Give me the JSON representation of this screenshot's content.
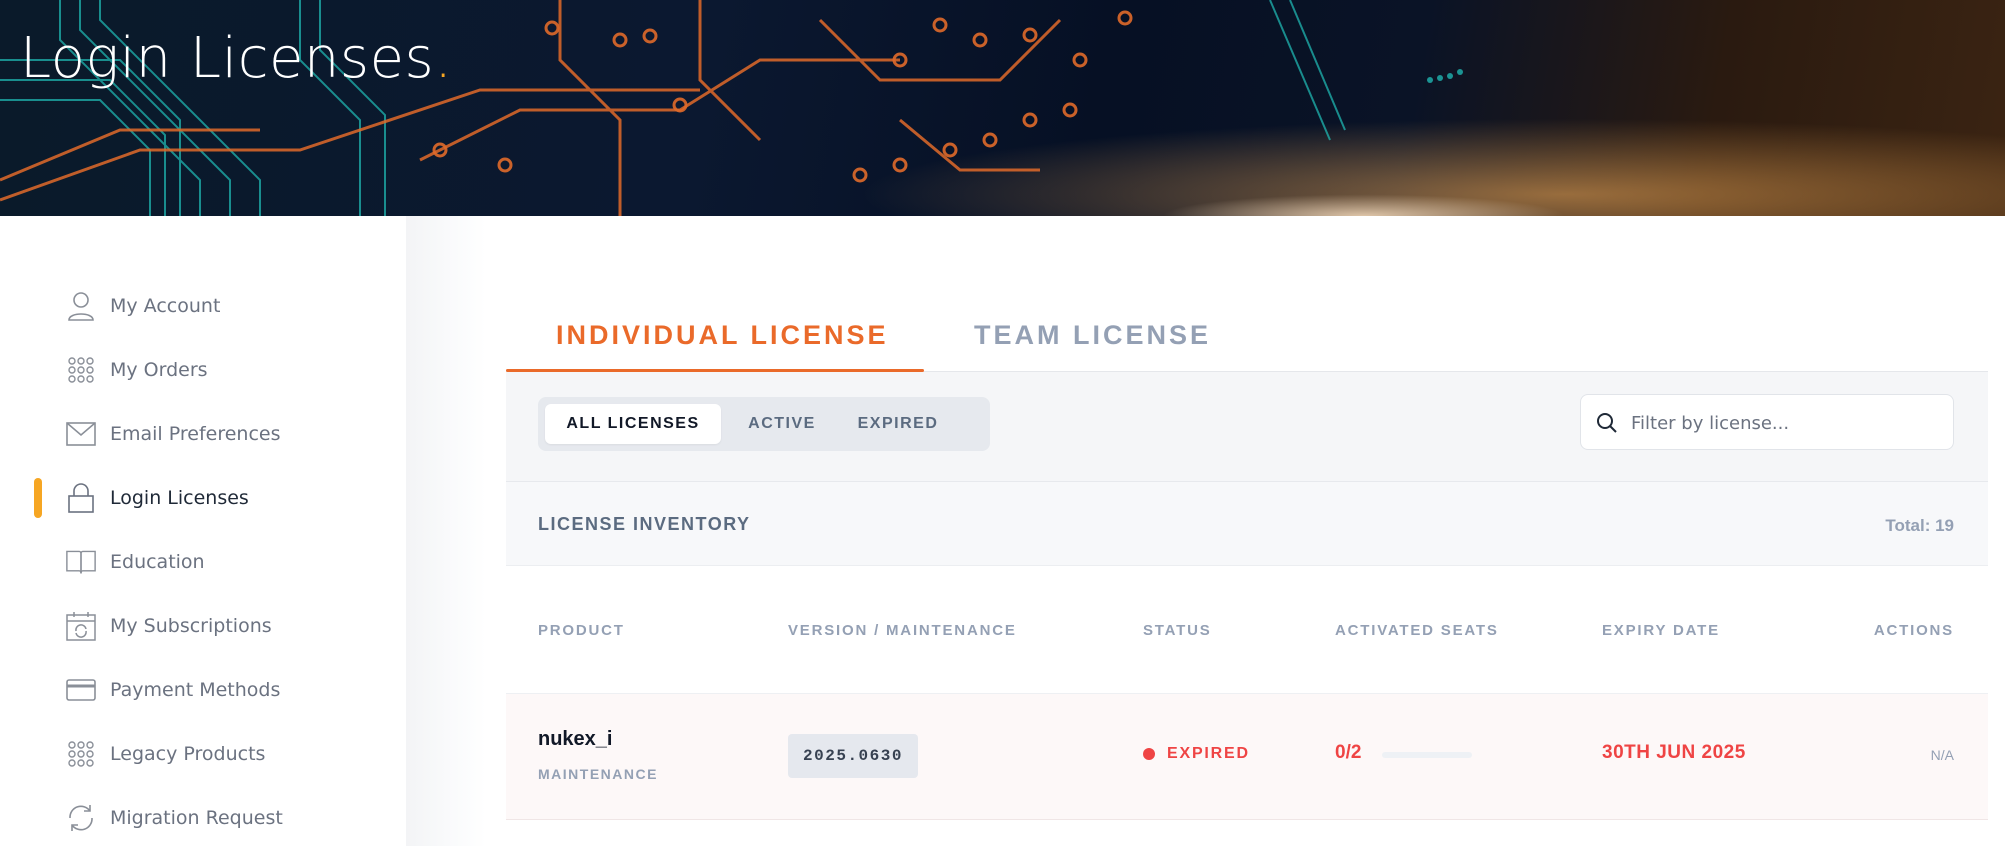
{
  "hero": {
    "title": "Login Licenses",
    "title_dot": "."
  },
  "sidebar": {
    "items": [
      {
        "label": "My Account",
        "icon": "user-icon",
        "active": false
      },
      {
        "label": "My Orders",
        "icon": "grid-dots-icon",
        "active": false
      },
      {
        "label": "Email Preferences",
        "icon": "envelope-icon",
        "active": false
      },
      {
        "label": "Login Licenses",
        "icon": "lock-icon",
        "active": true
      },
      {
        "label": "Education",
        "icon": "book-icon",
        "active": false
      },
      {
        "label": "My Subscriptions",
        "icon": "calendar-refresh-icon",
        "active": false
      },
      {
        "label": "Payment Methods",
        "icon": "credit-card-icon",
        "active": false
      },
      {
        "label": "Legacy Products",
        "icon": "grid-dots-icon",
        "active": false
      },
      {
        "label": "Migration Request",
        "icon": "refresh-icon",
        "active": false
      }
    ],
    "accent_color": "#f6a623"
  },
  "tabs": [
    {
      "label": "INDIVIDUAL LICENSE",
      "selected": true
    },
    {
      "label": "TEAM LICENSE",
      "selected": false
    }
  ],
  "filter": {
    "segments": [
      "ALL LICENSES",
      "ACTIVE",
      "EXPIRED"
    ],
    "selected": "ALL LICENSES",
    "search_placeholder": "Filter by license..."
  },
  "inventory": {
    "title": "LICENSE INVENTORY",
    "total": "Total: 19"
  },
  "table": {
    "headers": [
      "PRODUCT",
      "VERSION / MAINTENANCE",
      "STATUS",
      "ACTIVATED SEATS",
      "EXPIRY DATE",
      "ACTIONS"
    ],
    "rows": [
      {
        "product": "nukex_i",
        "product_type": "MAINTENANCE",
        "version": "2025.0630",
        "status": "EXPIRED",
        "seats": "0/2",
        "seats_fraction": 0,
        "expiry": "30TH JUN 2025",
        "actions": "N/A"
      }
    ]
  },
  "colors": {
    "accent_orange": "#ea6a2a",
    "expired_red": "#ef4444",
    "muted": "#94a0b4"
  }
}
